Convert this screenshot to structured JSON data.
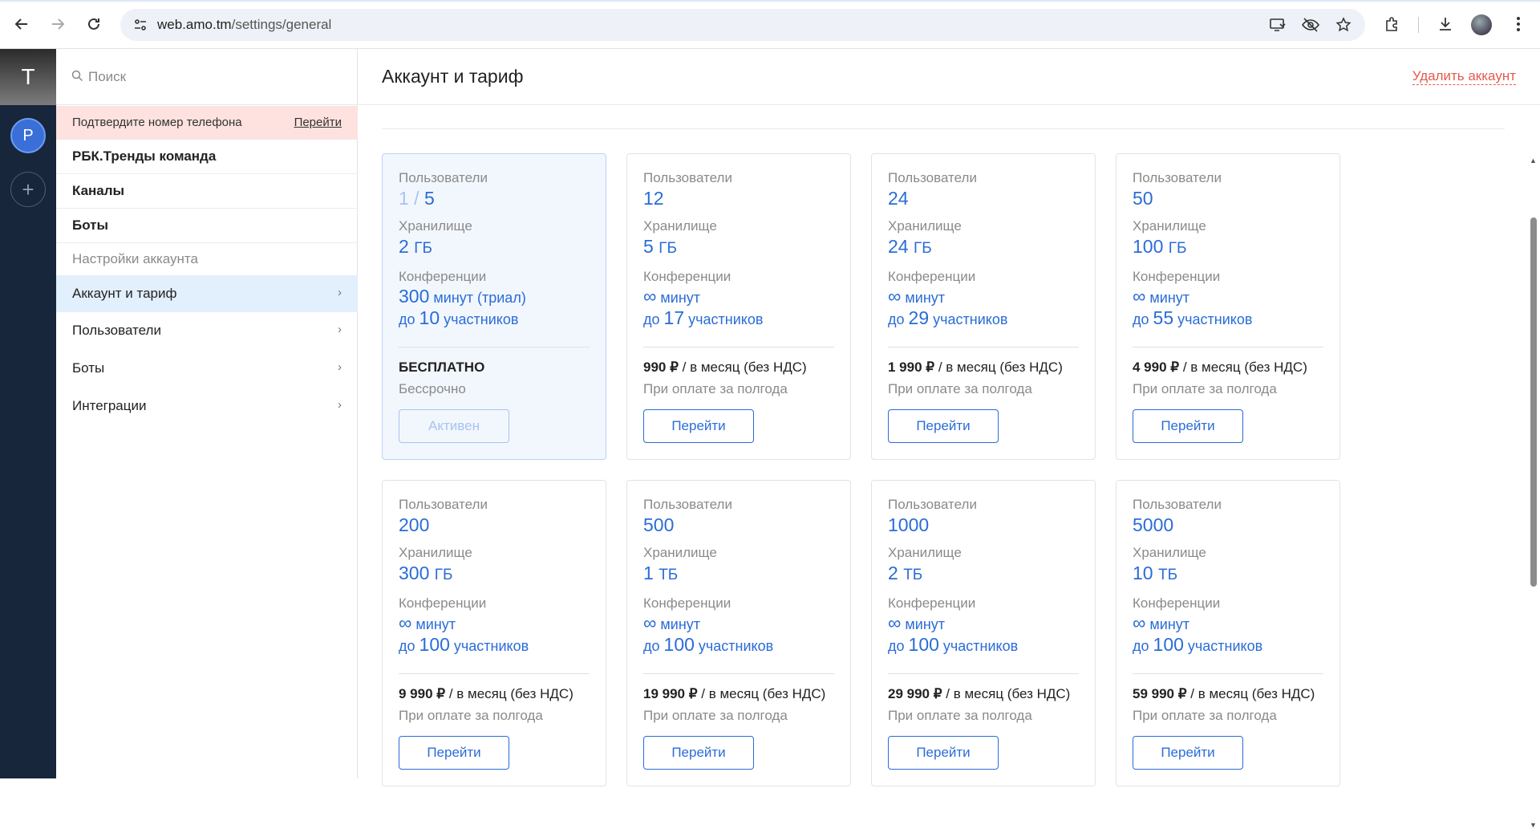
{
  "browser": {
    "url_host": "web.amo.tm",
    "url_path": "/settings/general"
  },
  "rail": {
    "workspace_letter": "T",
    "avatar_letter": "P",
    "add_symbol": "+"
  },
  "sidebar": {
    "search_placeholder": "Поиск",
    "phone_banner": {
      "text": "Подтвердите номер телефона",
      "link": "Перейти"
    },
    "sections": [
      "РБК.Тренды команда",
      "Каналы",
      "Боты"
    ],
    "settings_label": "Настройки аккаунта",
    "menu": [
      {
        "label": "Аккаунт и тариф",
        "active": true
      },
      {
        "label": "Пользователи",
        "active": false
      },
      {
        "label": "Боты",
        "active": false
      },
      {
        "label": "Интеграции",
        "active": false
      }
    ]
  },
  "main": {
    "title": "Аккаунт и тариф",
    "delete_link": "Удалить аккаунт",
    "labels": {
      "users": "Пользователи",
      "storage": "Хранилище",
      "conferences": "Конференции",
      "upto": "до",
      "participants": "участников",
      "minutes": "минут",
      "per_month": "/ в месяц (без НДС)",
      "half_year": "При оплате за полгода"
    },
    "plans": [
      {
        "users_used": "1",
        "users": "5",
        "storage": "2",
        "storage_unit": "ГБ",
        "minutes": "300",
        "minutes_suffix": "минут (триал)",
        "participants": "10",
        "price": "БЕСПЛАТНО",
        "note": "Бессрочно",
        "button": "Активен",
        "current": true
      },
      {
        "users": "12",
        "storage": "5",
        "storage_unit": "ГБ",
        "minutes": "∞",
        "participants": "17",
        "price": "990 ₽",
        "button": "Перейти"
      },
      {
        "users": "24",
        "storage": "24",
        "storage_unit": "ГБ",
        "minutes": "∞",
        "participants": "29",
        "price": "1 990 ₽",
        "button": "Перейти"
      },
      {
        "users": "50",
        "storage": "100",
        "storage_unit": "ГБ",
        "minutes": "∞",
        "participants": "55",
        "price": "4 990 ₽",
        "button": "Перейти"
      },
      {
        "users": "200",
        "storage": "300",
        "storage_unit": "ГБ",
        "minutes": "∞",
        "participants": "100",
        "price": "9 990 ₽",
        "button": "Перейти"
      },
      {
        "users": "500",
        "storage": "1",
        "storage_unit": "ТБ",
        "minutes": "∞",
        "participants": "100",
        "price": "19 990 ₽",
        "button": "Перейти"
      },
      {
        "users": "1000",
        "storage": "2",
        "storage_unit": "ТБ",
        "minutes": "∞",
        "participants": "100",
        "price": "29 990 ₽",
        "button": "Перейти"
      },
      {
        "users": "5000",
        "storage": "10",
        "storage_unit": "ТБ",
        "minutes": "∞",
        "participants": "100",
        "price": "59 990 ₽",
        "button": "Перейти"
      }
    ]
  },
  "colors": {
    "accent": "#2a6cd8",
    "danger": "#e45a4f",
    "rail": "#17263a",
    "active_menu": "#e2effc"
  }
}
